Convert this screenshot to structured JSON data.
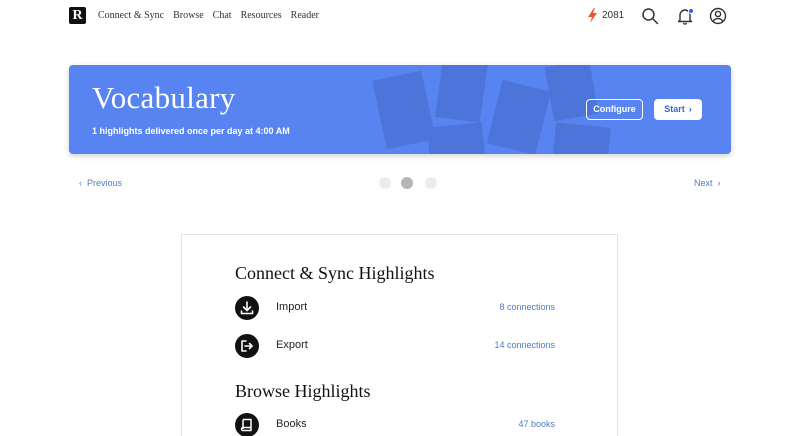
{
  "nav": {
    "logo_letter": "R",
    "links": [
      "Connect & Sync",
      "Browse",
      "Chat",
      "Resources",
      "Reader"
    ],
    "streak_count": "2081",
    "accent_color": "#2f5de8"
  },
  "hero": {
    "title": "Vocabulary",
    "subtitle": "1 highlights delivered once per day at 4:00 AM",
    "configure_label": "Configure",
    "start_label": "Start",
    "background_color": "#5884f2"
  },
  "pager": {
    "prev_label": "Previous",
    "next_label": "Next",
    "dots": 3,
    "active_dot": 2
  },
  "card": {
    "sections": [
      {
        "title": "Connect & Sync Highlights",
        "items": [
          {
            "label": "Import",
            "count": "8 connections",
            "icon": "download-icon"
          },
          {
            "label": "Export",
            "count": "14 connections",
            "icon": "export-icon"
          }
        ]
      },
      {
        "title": "Browse Highlights",
        "items": [
          {
            "label": "Books",
            "count": "47 books",
            "icon": "book-icon"
          }
        ]
      }
    ]
  }
}
